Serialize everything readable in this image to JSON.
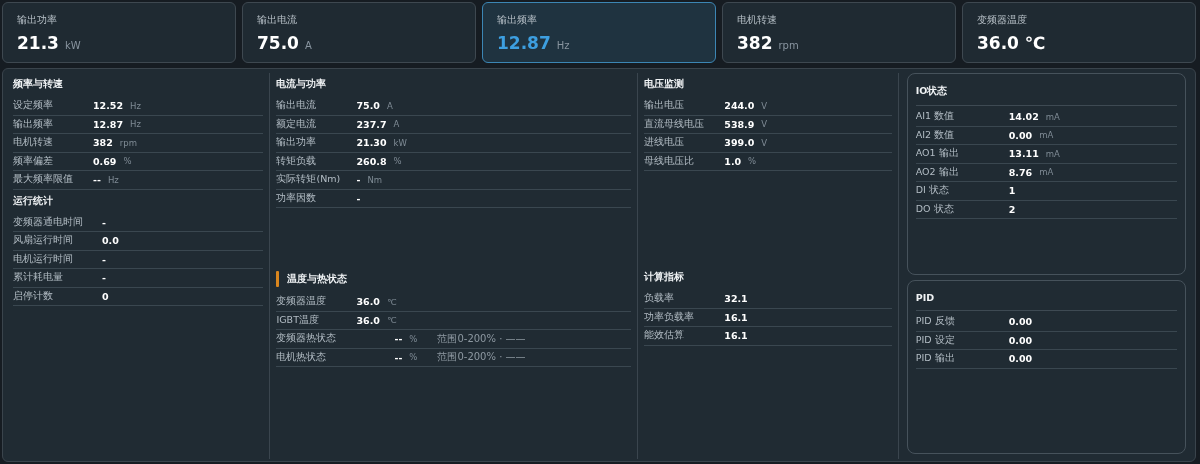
{
  "metrics": [
    {
      "label": "输出功率",
      "value": "21.3",
      "unit": "kW",
      "selected": false
    },
    {
      "label": "输出电流",
      "value": "75.0",
      "unit": "A",
      "selected": false
    },
    {
      "label": "输出频率",
      "value": "12.87",
      "unit": "Hz",
      "selected": true
    },
    {
      "label": "电机转速",
      "value": "382",
      "unit": "rpm",
      "selected": false
    },
    {
      "label": "变频器温度",
      "value": "36.0 ℃",
      "selected": false
    }
  ],
  "columns": [
    {
      "kind": "stack",
      "sections": [
        {
          "title": "频率与转速",
          "accent": false,
          "rows": [
            {
              "kind": "reading",
              "label": "设定频率",
              "value": "12.52",
              "unit": "Hz"
            },
            {
              "kind": "reading",
              "label": "输出频率",
              "value": "12.87",
              "unit": "Hz"
            },
            {
              "kind": "reading",
              "label": "电机转速",
              "value": "382",
              "unit": "rpm"
            },
            {
              "kind": "reading",
              "label": "频率偏差",
              "value": "0.69",
              "unit": "%"
            },
            {
              "kind": "reading",
              "label": "最大频率限值",
              "value": "--",
              "unit": "Hz"
            }
          ]
        },
        {
          "title": "运行统计",
          "accent": false,
          "rows": [
            {
              "kind": "wide",
              "label": "变频器通电时间",
              "value": "-"
            },
            {
              "kind": "wide",
              "label": "风扇运行时间",
              "value": "0.0"
            },
            {
              "kind": "wide",
              "label": "电机运行时间",
              "value": "-"
            },
            {
              "kind": "wide",
              "label": "累计耗电量",
              "value": "-"
            },
            {
              "kind": "wide",
              "label": "启停计数",
              "value": "0"
            }
          ]
        }
      ]
    },
    {
      "kind": "split",
      "sections": [
        {
          "title": "电流与功率",
          "accent": false,
          "rows": [
            {
              "kind": "reading",
              "label": "输出电流",
              "value": "75.0",
              "unit": "A"
            },
            {
              "kind": "reading",
              "label": "额定电流",
              "value": "237.7",
              "unit": "A"
            },
            {
              "kind": "reading",
              "label": "输出功率",
              "value": "21.30",
              "unit": "kW"
            },
            {
              "kind": "reading",
              "label": "转矩负载",
              "value": "260.8",
              "unit": "%"
            },
            {
              "kind": "reading",
              "label": "实际转矩(Nm)",
              "value": "-",
              "unit": "Nm"
            },
            {
              "kind": "reading",
              "label": "功率因数",
              "value": "-"
            }
          ]
        },
        {
          "title": "温度与热状态",
          "accent": true,
          "rows": [
            {
              "kind": "reading",
              "label": "变频器温度",
              "value": "36.0",
              "unit": "℃"
            },
            {
              "kind": "reading",
              "label": "IGBT温度",
              "value": "36.0",
              "unit": "℃"
            },
            {
              "kind": "thermal",
              "label": "变频器热状态",
              "value": "--",
              "unit": "%",
              "note": "范围0-200% · ——"
            },
            {
              "kind": "thermal",
              "label": "电机热状态",
              "value": "--",
              "unit": "%",
              "note": "范围0-200% · ——"
            }
          ]
        }
      ]
    },
    {
      "kind": "split",
      "sections": [
        {
          "title": "电压监测",
          "accent": false,
          "rows": [
            {
              "kind": "reading",
              "label": "输出电压",
              "value": "244.0",
              "unit": "V"
            },
            {
              "kind": "reading",
              "label": "直流母线电压",
              "value": "538.9",
              "unit": "V"
            },
            {
              "kind": "reading",
              "label": "进线电压",
              "value": "399.0",
              "unit": "V"
            },
            {
              "kind": "reading",
              "label": "母线电压比",
              "value": "1.0",
              "unit": "%"
            }
          ]
        },
        {
          "title": "计算指标",
          "accent": false,
          "rows": [
            {
              "kind": "reading",
              "label": "负载率",
              "value": "32.1"
            },
            {
              "kind": "reading",
              "label": "功率负载率",
              "value": "16.1"
            },
            {
              "kind": "reading",
              "label": "能效估算",
              "value": "16.1"
            }
          ]
        }
      ]
    },
    {
      "kind": "panels",
      "sections": [
        {
          "title": "IO状态",
          "accent": false,
          "rows": [
            {
              "kind": "reading",
              "label": "AI1 数值",
              "value": "14.02",
              "unit": "mA"
            },
            {
              "kind": "reading",
              "label": "AI2 数值",
              "value": "0.00",
              "unit": "mA"
            },
            {
              "kind": "reading",
              "label": "AO1 输出",
              "value": "13.11",
              "unit": "mA"
            },
            {
              "kind": "reading",
              "label": "AO2 输出",
              "value": "8.76",
              "unit": "mA"
            },
            {
              "kind": "reading",
              "label": "DI 状态",
              "value": "1"
            },
            {
              "kind": "reading",
              "label": "DO 状态",
              "value": "2"
            }
          ]
        },
        {
          "title": "PID",
          "accent": false,
          "rows": [
            {
              "kind": "reading",
              "label": "PID 反馈",
              "value": "0.00"
            },
            {
              "kind": "reading",
              "label": "PID 设定",
              "value": "0.00"
            },
            {
              "kind": "reading",
              "label": "PID 输出",
              "value": "0.00"
            }
          ]
        }
      ]
    }
  ]
}
